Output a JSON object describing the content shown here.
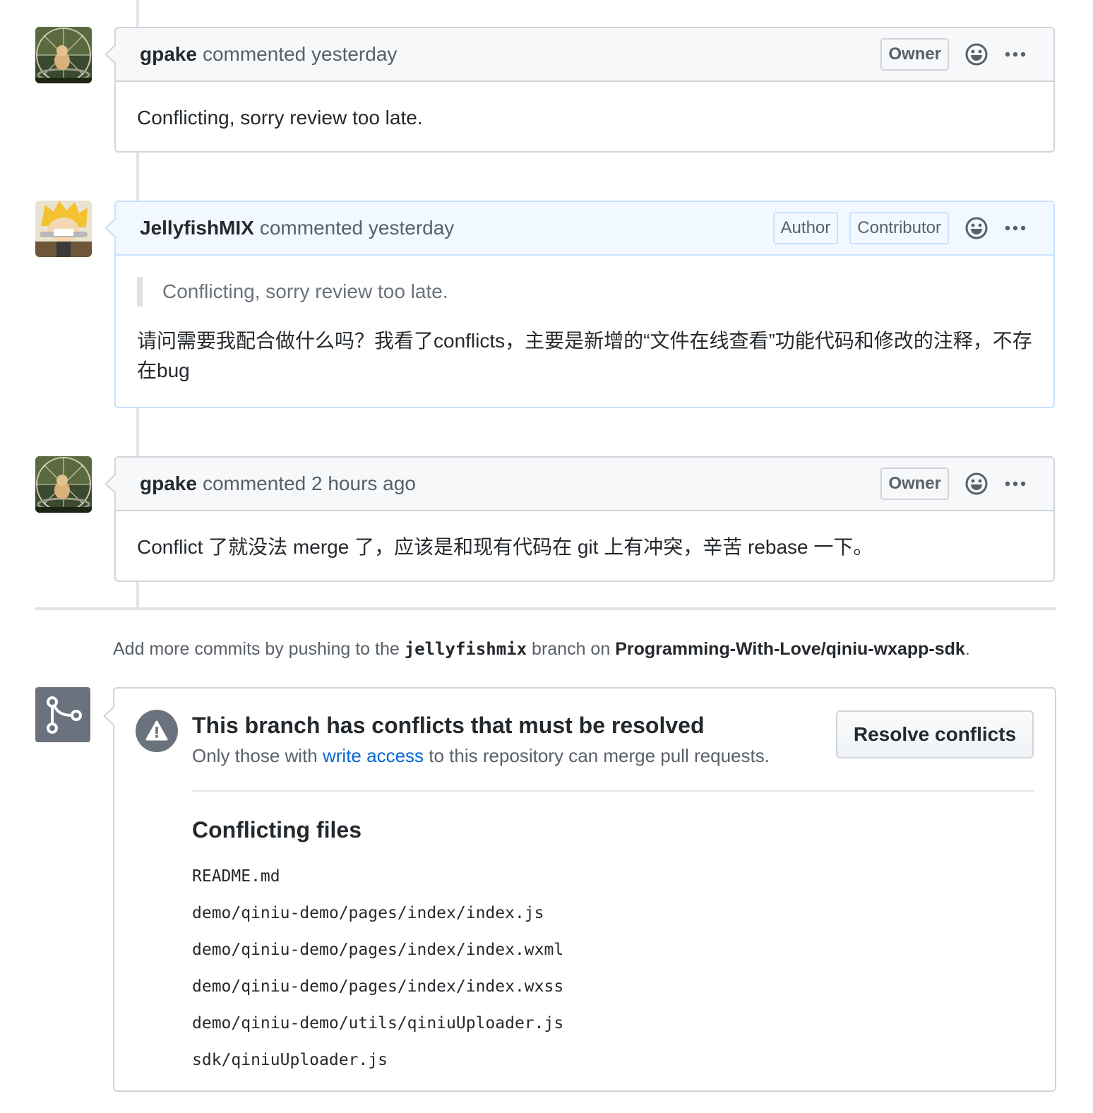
{
  "colors": {
    "link": "#0366d6",
    "muted_text": "#586069",
    "border": "#d1d5da",
    "author_border": "#c8e1ff",
    "author_header_bg": "#f1f8ff",
    "header_bg": "#f6f8fa",
    "icon_gray": "#6a737d"
  },
  "comments": [
    {
      "author": "gpake",
      "action": "commented yesterday",
      "badges": [
        "Owner"
      ],
      "avatar_icon": "cat-on-wheel-avatar",
      "body": "Conflicting, sorry review too late."
    },
    {
      "author": "JellyfishMIX",
      "action": "commented yesterday",
      "badges": [
        "Author",
        "Contributor"
      ],
      "avatar_icon": "anime-character-avatar",
      "quote": "Conflicting, sorry review too late.",
      "body": "请问需要我配合做什么吗？我看了conflicts，主要是新增的“文件在线查看”功能代码和修改的注释，不存在bug"
    },
    {
      "author": "gpake",
      "action": "commented 2 hours ago",
      "badges": [
        "Owner"
      ],
      "avatar_icon": "cat-on-wheel-avatar",
      "body": "Conflict 了就没法 merge 了，应该是和现有代码在 git 上有冲突，辛苦 rebase 一下。"
    }
  ],
  "push_hint": {
    "prefix": "Add more commits by pushing to the",
    "branch": "jellyfishmix",
    "middle": "branch on",
    "repo": "Programming-With-Love/qiniu-wxapp-sdk",
    "suffix": "."
  },
  "merge_status": {
    "icon": "git-merge-icon",
    "warning_icon": "alert-icon",
    "title": "This branch has conflicts that must be resolved",
    "subtitle_prefix": "Only those with",
    "subtitle_link": "write access",
    "subtitle_suffix": "to this repository can merge pull requests.",
    "resolve_button": "Resolve conflicts",
    "files_title": "Conflicting files",
    "files": [
      "README.md",
      "demo/qiniu-demo/pages/index/index.js",
      "demo/qiniu-demo/pages/index/index.wxml",
      "demo/qiniu-demo/pages/index/index.wxss",
      "demo/qiniu-demo/utils/qiniuUploader.js",
      "sdk/qiniuUploader.js"
    ]
  }
}
